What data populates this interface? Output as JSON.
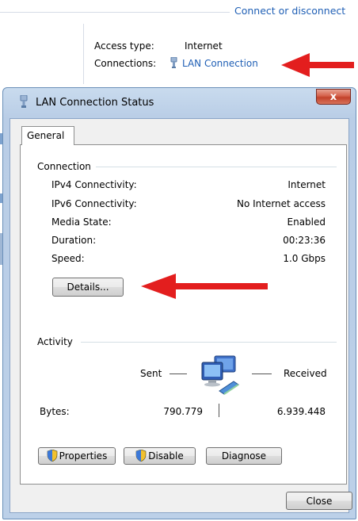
{
  "background": {
    "link": "Connect or disconnect",
    "access_type_label": "Access type:",
    "access_type_value": "Internet",
    "connections_label": "Connections:",
    "connections_value": "LAN Connection"
  },
  "dialog": {
    "title": "LAN Connection Status",
    "close_glyph": "x",
    "tab": "General",
    "connection": {
      "heading": "Connection",
      "rows": [
        {
          "label": "IPv4 Connectivity:",
          "value": "Internet"
        },
        {
          "label": "IPv6 Connectivity:",
          "value": "No Internet access"
        },
        {
          "label": "Media State:",
          "value": "Enabled"
        },
        {
          "label": "Duration:",
          "value": "00:23:36"
        },
        {
          "label": "Speed:",
          "value": "1.0 Gbps"
        }
      ],
      "details_button": "Details..."
    },
    "activity": {
      "heading": "Activity",
      "sent_label": "Sent",
      "received_label": "Received",
      "bytes_label": "Bytes:",
      "bytes_sent": "790.779",
      "bytes_received": "6.939.448"
    },
    "buttons": {
      "properties": "Properties",
      "disable": "Disable",
      "diagnose": "Diagnose",
      "close": "Close"
    }
  },
  "colors": {
    "link": "#1f5fb5",
    "arrow": "#e31e1e",
    "close_button": "#c2412a"
  },
  "icons": [
    "plug-icon",
    "network-computers-icon",
    "uac-shield-icon",
    "red-arrow"
  ]
}
